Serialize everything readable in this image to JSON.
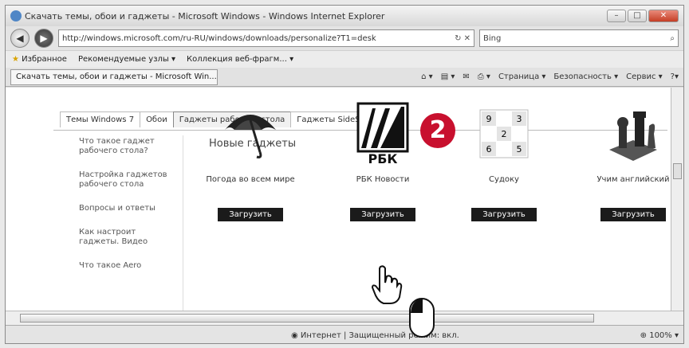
{
  "browser": {
    "title": "Скачать темы, обои и гаджеты - Microsoft Windows - Windows Internet Explorer",
    "address": "http://windows.microsoft.com/ru-RU/windows/downloads/personalize?T1=desk",
    "search_text": "Bing",
    "favorites": [
      "Избранное",
      "Рекомендуемые узлы ▾",
      "Коллекция веб-фрагм... ▾"
    ],
    "tab_label": "Скачать темы, обои и гаджеты - Microsoft Win...",
    "commands": [
      "Страница ▾",
      "Безопасность ▾",
      "Сервис ▾"
    ],
    "status_zone": "Интернет | Защищенный режим: вкл.",
    "zoom": "100%"
  },
  "page": {
    "tabs": [
      "Темы Windows 7",
      "Обои",
      "Гаджеты рабочего стола",
      "Гаджеты SideShow"
    ],
    "active_tab": 2,
    "side_nav": [
      "Что такое гаджет рабочего стола?",
      "Настройка гаджетов рабочего стола",
      "Вопросы и ответы",
      "Как настроит гаджеты. Видео",
      "Что такое Aero"
    ],
    "heading": "Новые гаджеты",
    "step_badge": "2",
    "gadgets": [
      {
        "name": "Погода во всем мире",
        "button": "Загрузить",
        "icon": "umbrella-icon"
      },
      {
        "name": "РБК Новости",
        "button": "Загрузить",
        "icon": "rbc-logo-icon",
        "logo_text": "РБК"
      },
      {
        "name": "Судоку",
        "button": "Загрузить",
        "icon": "sudoku-icon",
        "digits": [
          "9",
          "3",
          "2",
          "6",
          "5"
        ]
      },
      {
        "name": "Учим английский",
        "button": "Загрузить",
        "icon": "chess-pieces-icon"
      }
    ]
  }
}
